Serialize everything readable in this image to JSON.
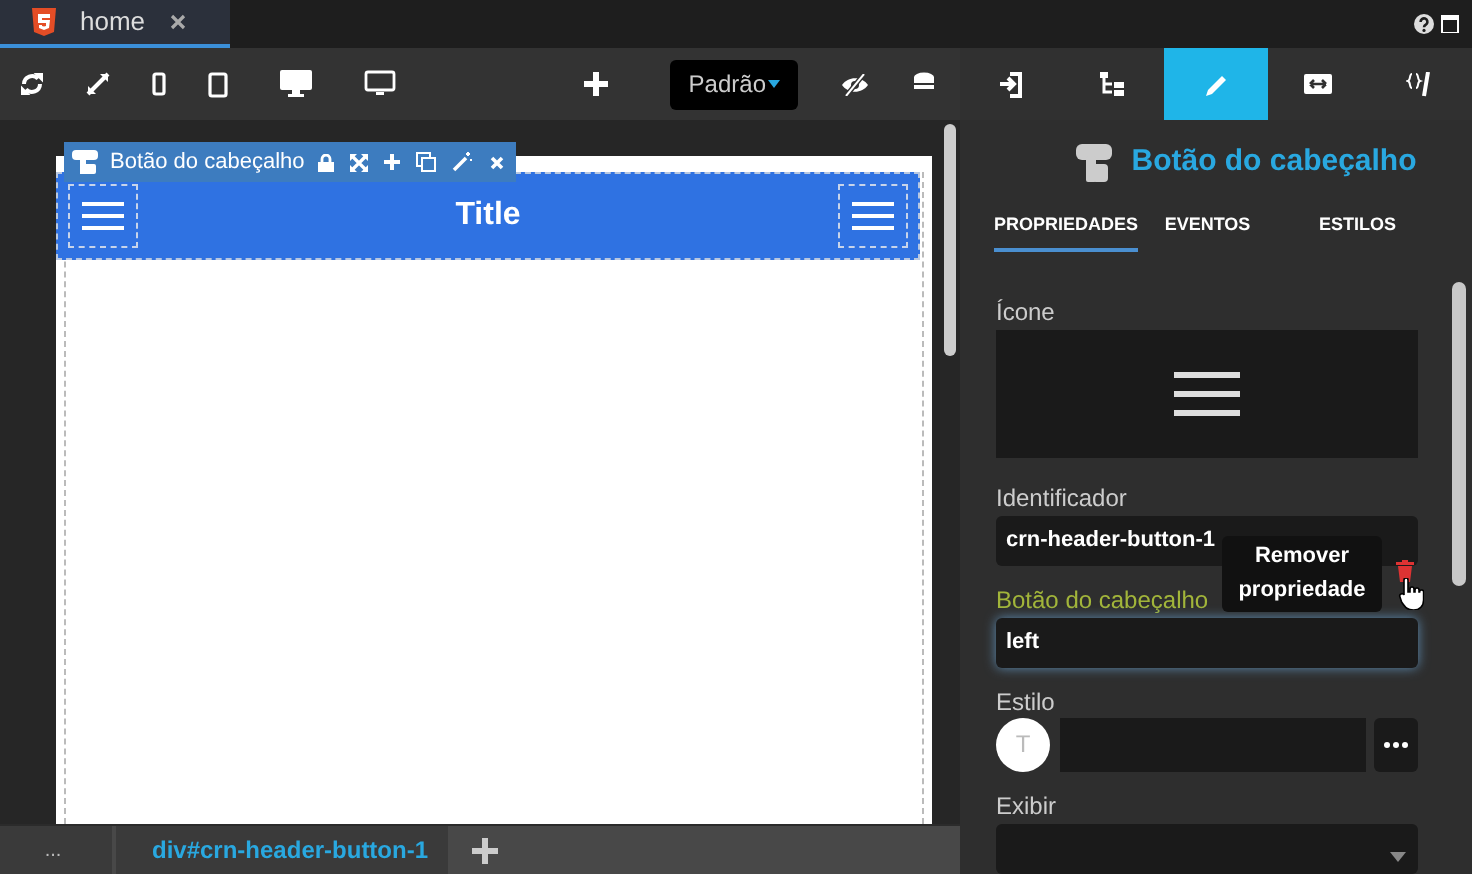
{
  "editor_tab": {
    "label": "home",
    "selected": true
  },
  "toolbar": {
    "theme_select": "Padrão"
  },
  "element_toolbar": {
    "label": "Botão do cabeçalho"
  },
  "canvas_header": {
    "title": "Title"
  },
  "breadcrumb": [
    "...",
    "div#crn-header-button-1"
  ],
  "panel_tabs": [
    {
      "kind": "import",
      "selected": false
    },
    {
      "kind": "tree",
      "selected": false
    },
    {
      "kind": "edit",
      "selected": true
    },
    {
      "kind": "resize",
      "selected": false
    },
    {
      "kind": "code",
      "selected": false
    }
  ],
  "panel_title": "Botão do cabeçalho",
  "subtabs": [
    {
      "label": "PROPRIEDADES",
      "selected": true
    },
    {
      "label": "EVENTOS",
      "selected": false
    },
    {
      "label": "ESTILOS",
      "selected": false
    }
  ],
  "fields": [
    {
      "kind": "icon",
      "label": "Ícone"
    },
    {
      "kind": "text",
      "label": "Identificador",
      "value": "crn-header-button-1",
      "focused": false,
      "modified": false
    },
    {
      "kind": "text",
      "label": "Botão do cabeçalho",
      "value": "left",
      "focused": true,
      "modified": true
    },
    {
      "kind": "style",
      "label": "Estilo",
      "avatar": "T"
    },
    {
      "kind": "select",
      "label": "Exibir"
    }
  ],
  "tooltip": "Remover propriedade"
}
